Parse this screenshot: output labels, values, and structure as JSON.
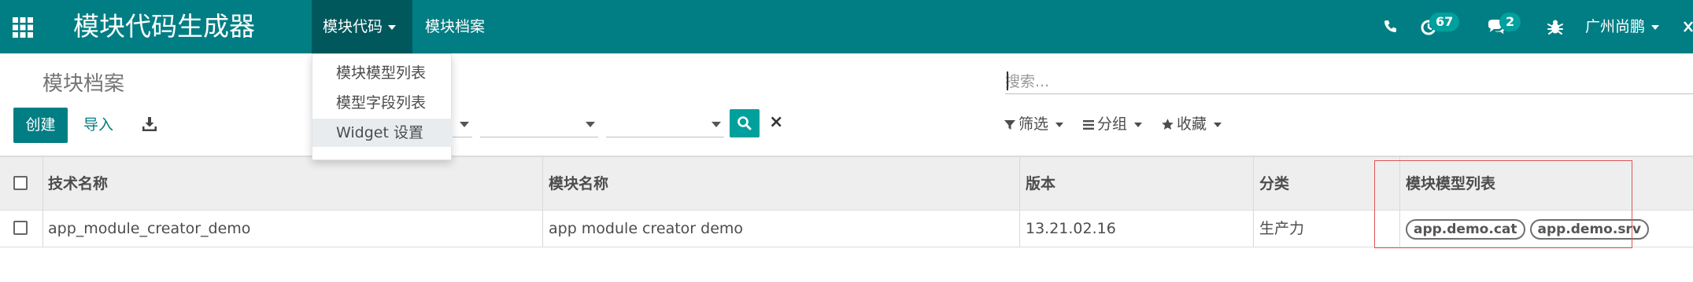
{
  "app": {
    "brand": "模块代码生成器",
    "menus": [
      {
        "label": "模块代码",
        "has_caret": true,
        "active": true
      },
      {
        "label": "模块档案",
        "has_caret": false,
        "active": false
      }
    ]
  },
  "systray": {
    "phone_icon": "phone-icon",
    "activity_icon": "clock-icon",
    "activity_count": "67",
    "messages_icon": "chat-bubbles-icon",
    "messages_count": "2",
    "debug_icon": "bug-icon",
    "user_name": "广州尚鹏"
  },
  "dropdown": {
    "items": [
      {
        "label": "模块模型列表",
        "highlighted": false
      },
      {
        "label": "模型字段列表",
        "highlighted": false
      },
      {
        "label": "Widget 设置",
        "highlighted": true
      }
    ]
  },
  "control_panel": {
    "title": "模块档案",
    "create_label": "创建",
    "import_label": "导入",
    "download_icon": "download-icon",
    "search_placeholder": "搜索...",
    "search_button_icon": "search-icon",
    "clear_label": "×",
    "filters_label": "筛选",
    "groupby_label": "分组",
    "favorites_label": "收藏"
  },
  "list": {
    "columns": [
      "技术名称",
      "模块名称",
      "版本",
      "分类",
      "模块模型列表"
    ],
    "rows": [
      {
        "technical_name": "app_module_creator_demo",
        "module_name": "app module creator demo",
        "version": "13.21.02.16",
        "category": "生产力",
        "models": [
          "app.demo.cat",
          "app.demo.srv"
        ]
      }
    ]
  },
  "colors": {
    "primary": "#017e84",
    "primary_dark": "#01585c",
    "accent": "#00a09d",
    "highlight_border": "#e05555"
  }
}
